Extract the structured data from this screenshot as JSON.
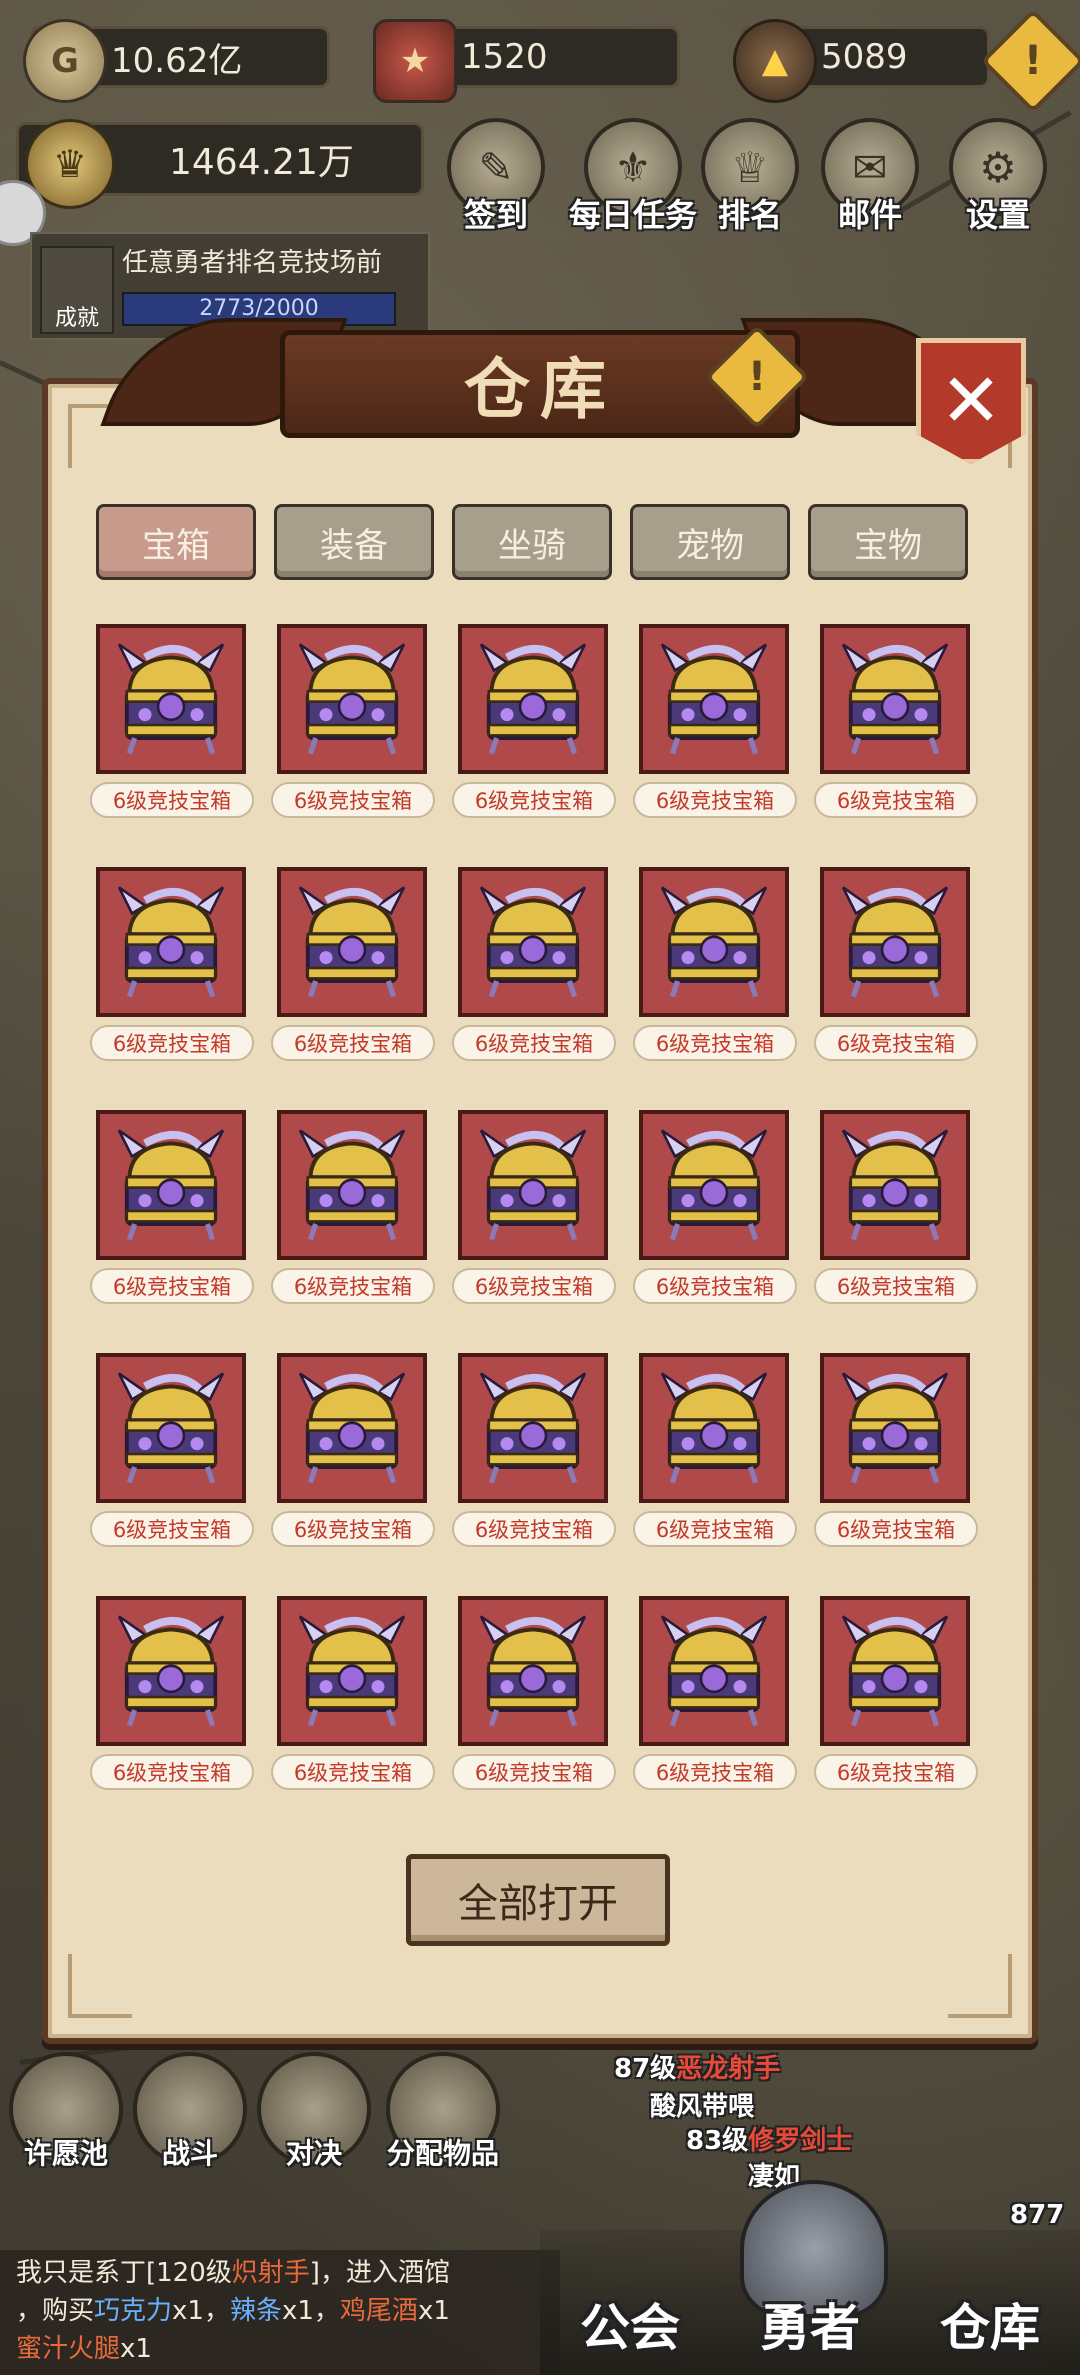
{
  "resources": {
    "gold": "10.62亿",
    "shield": "1520",
    "stone": "5089",
    "power": "1464.21万"
  },
  "top_buttons": [
    "签到",
    "每日任务",
    "排名",
    "邮件",
    "设置"
  ],
  "quest": {
    "text": "任意勇者排名竞技场前",
    "progress": "2773/2000",
    "badge": "成就"
  },
  "panel": {
    "title": "仓库",
    "close_symbol": "✕",
    "tabs": [
      {
        "label": "宝箱",
        "active": true
      },
      {
        "label": "装备",
        "active": false
      },
      {
        "label": "坐骑",
        "active": false
      },
      {
        "label": "宠物",
        "active": false
      },
      {
        "label": "宝物",
        "active": false
      }
    ],
    "items": [
      "6级竞技宝箱",
      "6级竞技宝箱",
      "6级竞技宝箱",
      "6级竞技宝箱",
      "6级竞技宝箱",
      "6级竞技宝箱",
      "6级竞技宝箱",
      "6级竞技宝箱",
      "6级竞技宝箱",
      "6级竞技宝箱",
      "6级竞技宝箱",
      "6级竞技宝箱",
      "6级竞技宝箱",
      "6级竞技宝箱",
      "6级竞技宝箱",
      "6级竞技宝箱",
      "6级竞技宝箱",
      "6级竞技宝箱",
      "6级竞技宝箱",
      "6级竞技宝箱",
      "6级竞技宝箱",
      "6级竞技宝箱",
      "6级竞技宝箱",
      "6级竞技宝箱",
      "6级竞技宝箱"
    ],
    "open_all": "全部打开"
  },
  "bottom_functions": [
    "许愿池",
    "战斗",
    "对决",
    "分配物品"
  ],
  "field_notes": {
    "line1_level": "87级",
    "line1_name": "恶龙射手",
    "line2": "酸风带喂",
    "line3_level": "83级",
    "line3_name": "修罗剑士",
    "line4": "凄如",
    "corner_level": "877"
  },
  "chat": {
    "line1_pre": "我只是系丁[120级",
    "line1_red": "炽射手",
    "line1_post": "]，进入酒馆",
    "line2_pre": "，购买",
    "line2_item1": "巧克力",
    "line2_x1": "x1，",
    "line2_item2": "辣条",
    "line2_x2": "x1，",
    "line2_item3": "鸡尾酒",
    "line2_x3": "x1",
    "line3_item": "蜜汁火腿",
    "line3_x": "x1"
  },
  "bottom_nav": [
    "公会",
    "勇者",
    "仓库"
  ],
  "colors": {
    "panel_bg": "#ecdcbe",
    "chest_bg": "#b04a4a",
    "label_red": "#c43a2a",
    "tab_active": "#c89a8c"
  }
}
